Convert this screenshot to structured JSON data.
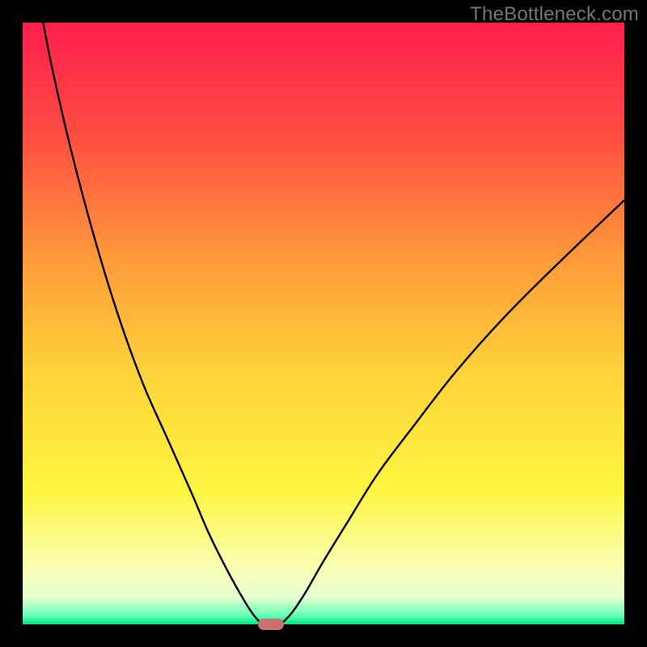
{
  "watermark": "TheBottleneck.com",
  "chart_data": {
    "type": "line",
    "title": "",
    "xlabel": "",
    "ylabel": "",
    "xlim": [
      0,
      100
    ],
    "ylim": [
      0,
      100
    ],
    "grid": false,
    "background_gradient": {
      "stops": [
        {
          "pos": 0.0,
          "color": "#ff1f4f"
        },
        {
          "pos": 0.18,
          "color": "#ff4b43"
        },
        {
          "pos": 0.4,
          "color": "#ff9d3a"
        },
        {
          "pos": 0.58,
          "color": "#ffd33a"
        },
        {
          "pos": 0.78,
          "color": "#fff642"
        },
        {
          "pos": 0.9,
          "color": "#fbffb0"
        },
        {
          "pos": 0.955,
          "color": "#e8ffd0"
        },
        {
          "pos": 0.985,
          "color": "#66ffb8"
        },
        {
          "pos": 1.0,
          "color": "#00e885"
        }
      ]
    },
    "series": [
      {
        "name": "left-curve",
        "x": [
          3.4,
          5,
          8,
          12,
          16,
          20,
          24,
          28,
          31,
          34,
          36.5,
          38.2,
          39.4,
          40.0
        ],
        "y": [
          100,
          92,
          79,
          64,
          51,
          40,
          31,
          22,
          15,
          9,
          4.5,
          1.8,
          0.4,
          0.0
        ]
      },
      {
        "name": "right-curve",
        "x": [
          42.6,
          43.4,
          44.8,
          47,
          50,
          54,
          59,
          65,
          72,
          80,
          89,
          100
        ],
        "y": [
          0.0,
          0.5,
          2.0,
          5.3,
          10.5,
          17,
          25,
          33,
          42,
          51,
          60,
          70.5
        ]
      }
    ],
    "marker": {
      "x_center": 41.3,
      "y": 0,
      "width_pct": 4.3
    },
    "colors": {
      "curve": "#000000",
      "marker": "#cc6f6e",
      "frame": "#000000"
    }
  }
}
